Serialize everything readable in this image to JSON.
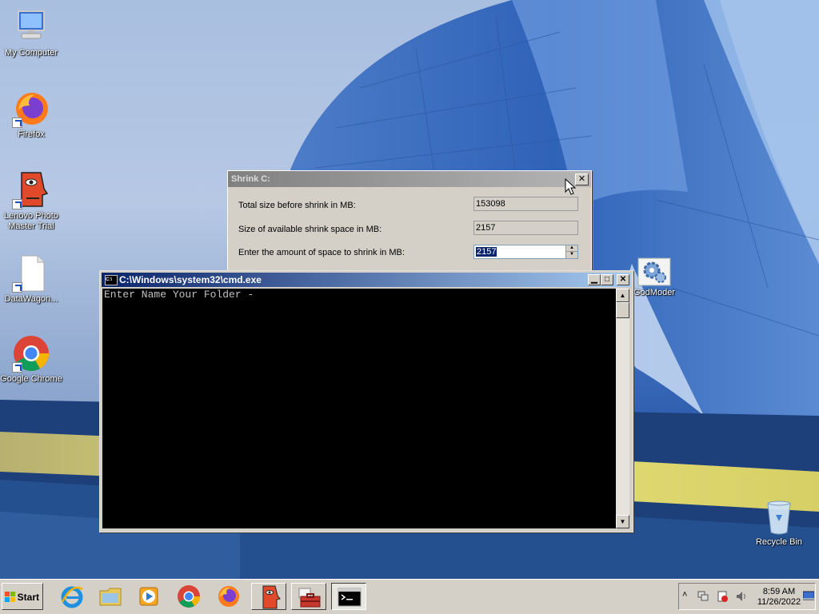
{
  "desktop_icons": [
    {
      "label": "My Computer"
    },
    {
      "label": "Firefox"
    },
    {
      "label": "Lenovo Photo Master Trial"
    },
    {
      "label": "DataWagon..."
    },
    {
      "label": "Google Chrome"
    },
    {
      "label": "GodModer"
    },
    {
      "label": "Recycle Bin"
    }
  ],
  "shrink_dialog": {
    "title": "Shrink C:",
    "rows": [
      {
        "label": "Total size before shrink in MB:",
        "value": "153098"
      },
      {
        "label": "Size of available shrink space in MB:",
        "value": "2157"
      },
      {
        "label": "Enter the amount of space to shrink in MB:",
        "value": "2157"
      }
    ]
  },
  "cmd_window": {
    "title": "C:\\Windows\\system32\\cmd.exe",
    "icon_text": "C:\\",
    "output": "Enter Name Your Folder -"
  },
  "taskbar": {
    "start_label": "Start",
    "apps": [
      "internet-explorer",
      "windows-explorer",
      "media-player",
      "google-chrome",
      "firefox",
      "lenovo-photo-master",
      "toolbox",
      "command-prompt"
    ],
    "time": "8:59 AM",
    "date": "11/26/2022"
  },
  "colors": {
    "cmd_title": "#0a246a",
    "selection": "#0a246a",
    "console_bg": "#000000",
    "console_text": "#c0c0c0"
  }
}
